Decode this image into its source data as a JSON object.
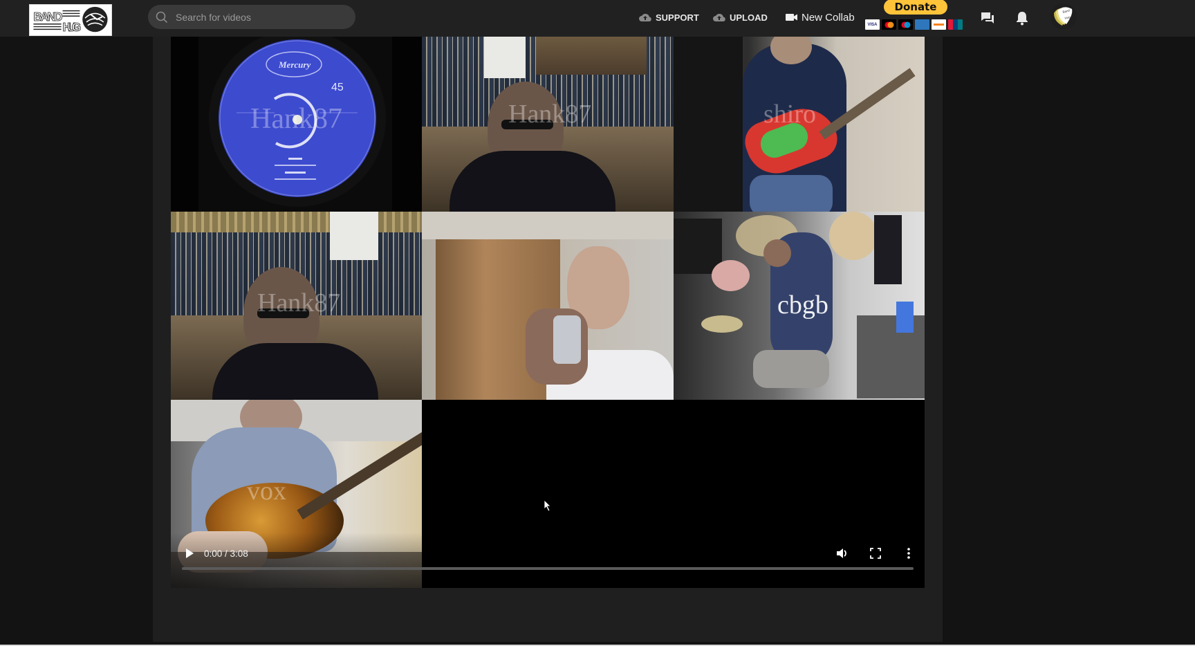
{
  "header": {
    "logo_text_top": "BAND",
    "logo_text_bottom": "HUG",
    "search": {
      "placeholder": "Search for videos",
      "value": ""
    },
    "nav": {
      "support_label": "SUPPORT",
      "upload_label": "UPLOAD",
      "new_collab_label": "New Collab"
    },
    "donate": {
      "label": "Donate",
      "cards": [
        "VISA",
        "Mastercard",
        "Maestro",
        "American Express",
        "Discover",
        "UnionPay"
      ]
    },
    "icons": [
      "chat-icon",
      "bell-icon"
    ],
    "avatar_text": "Band Hug"
  },
  "video": {
    "tiles": [
      {
        "name": "tile-record",
        "watermark": "Hank87",
        "record_label": "Mercury",
        "record_speed": "45"
      },
      {
        "name": "tile-bookshelf-man",
        "watermark": "Hank87"
      },
      {
        "name": "tile-guitarist-strat",
        "watermark": "shiro"
      },
      {
        "name": "tile-bookshelf-man-2",
        "watermark": "Hank87"
      },
      {
        "name": "tile-trumpet",
        "watermark": ""
      },
      {
        "name": "tile-drummer",
        "watermark": "cbgb"
      },
      {
        "name": "tile-guitarist-archtop",
        "watermark": "vox"
      }
    ],
    "controls": {
      "current_time": "0:00",
      "duration": "3:08",
      "time_display": "0:00 / 3:08",
      "progress_fraction": 0
    }
  }
}
